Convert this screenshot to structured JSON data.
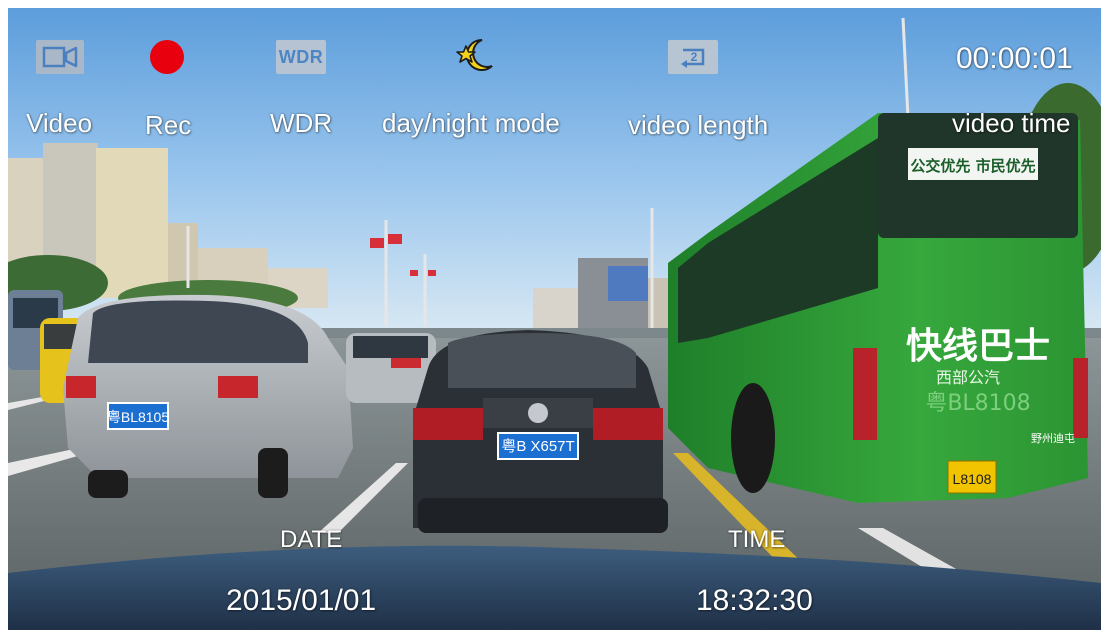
{
  "overlay": {
    "status_labels": {
      "video": "Video",
      "rec": "Rec",
      "wdr": "WDR",
      "day_night": "day/night mode",
      "video_length": "video length",
      "video_time": "video time"
    },
    "icons": {
      "video": "video-camera-icon",
      "rec": "record-dot-icon",
      "wdr": "wdr-icon",
      "wdr_text": "WDR",
      "day_night": "star-moon-icon",
      "video_length": "loop-2-icon",
      "video_length_number": "2"
    },
    "video_time_value": "00:00:01",
    "date_label": "DATE",
    "date_value": "2015/01/01",
    "time_label": "TIME",
    "time_value": "18:32:30"
  },
  "scene": {
    "bus_sign": "公交优先 市民优先",
    "bus_side_title": "快线巴士",
    "bus_side_subtitle": "西部公汽",
    "bus_side_plate": "粤BL8108",
    "bus_rear_plate": "L8108",
    "bus_rear_small": "野州迪屯",
    "car_center_plate": "粤B X657T",
    "car_left_plate": "粤BL8105"
  },
  "colors": {
    "rec_red": "#e8000e",
    "icon_bg": "#b6c3d2",
    "wdr_blue": "#4d86c6",
    "bus_green": "#2fa038",
    "plate_blue": "#1a6fd0",
    "plate_yellow": "#f2c400"
  }
}
